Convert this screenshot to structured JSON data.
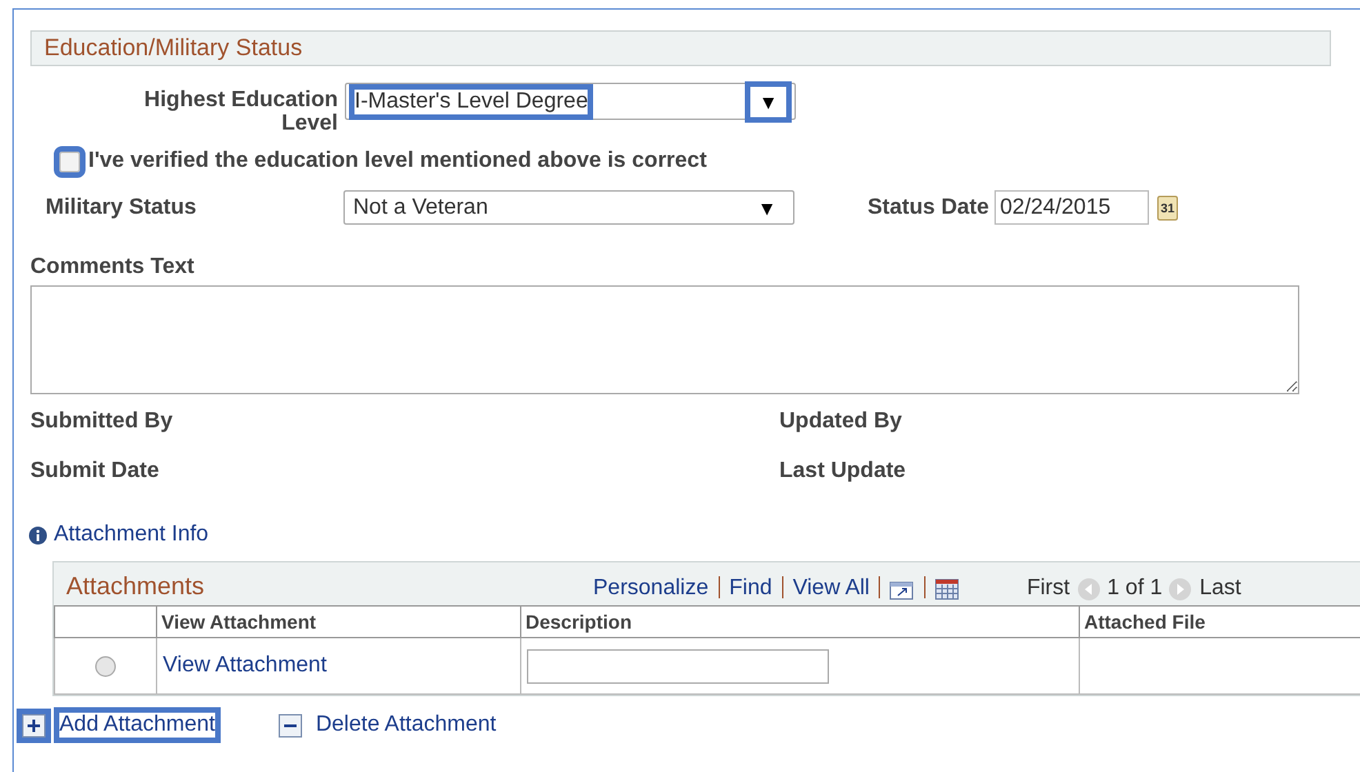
{
  "section": {
    "title": "Education/Military Status"
  },
  "education": {
    "label": "Highest Education Level",
    "value": "I-Master's Level Degree",
    "arrow": "▼",
    "value_highlighted": true,
    "arrow_highlighted": true
  },
  "verify": {
    "label": "I've verified the education level mentioned above is correct",
    "checked": false,
    "highlighted": true
  },
  "military": {
    "label": "Military Status",
    "value": "Not a Veteran",
    "arrow": "▼"
  },
  "status_date": {
    "label": "Status Date",
    "value": "02/24/2015",
    "calendar_day": "31"
  },
  "comments": {
    "label": "Comments Text"
  },
  "info_fields": [
    {
      "label": "Submitted By"
    },
    {
      "label": "Updated By"
    },
    {
      "label": "Submit Date"
    },
    {
      "label": "Last Update"
    }
  ],
  "attachment_info": {
    "label": "Attachment Info"
  },
  "grid": {
    "title": "Attachments",
    "links": [
      "Personalize",
      "Find",
      "View All"
    ],
    "first": "First",
    "count": "1 of 1",
    "last": "Last",
    "columns": [
      "View Attachment",
      "Description",
      "Attached File"
    ],
    "rows": [
      {
        "selected": false,
        "link": "View Attachment"
      }
    ]
  },
  "actions": [
    {
      "kind": "add",
      "label": "Add Attachment",
      "icon_highlighted": true,
      "label_highlighted": true
    },
    {
      "kind": "delete",
      "label": "Delete Attachment",
      "icon_highlighted": false,
      "label_highlighted": false
    }
  ]
}
